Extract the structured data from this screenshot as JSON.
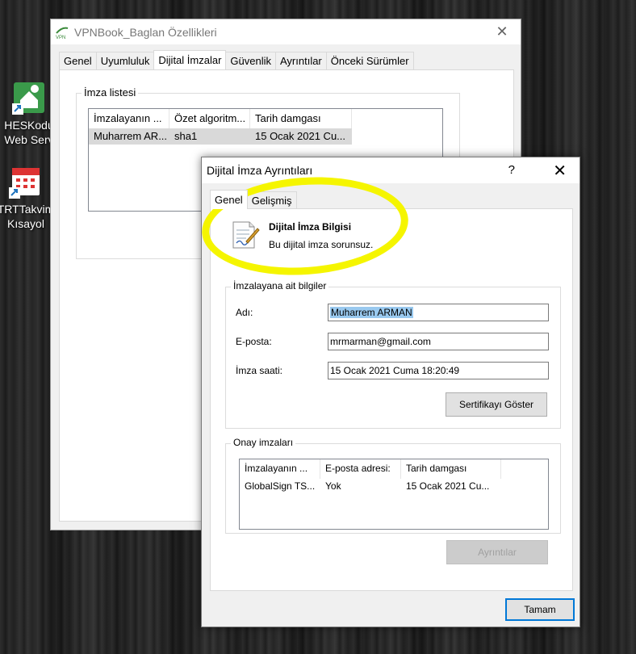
{
  "desktop": {
    "icons": [
      {
        "lines": [
          "HESKodu",
          "Web Serv"
        ]
      },
      {
        "lines": [
          "TRTTakvim",
          "Kısayol"
        ]
      }
    ]
  },
  "parent_window": {
    "title": "VPNBook_Baglan Özellikleri",
    "tabs": [
      "Genel",
      "Uyumluluk",
      "Dijital İmzalar",
      "Güvenlik",
      "Ayrıntılar",
      "Önceki Sürümler"
    ],
    "active_tab": "Dijital İmzalar",
    "signature_list": {
      "legend": "İmza listesi",
      "columns": [
        "İmzalayanın ...",
        "Özet algoritm...",
        "Tarih damgası"
      ],
      "rows": [
        [
          "Muharrem AR...",
          "sha1",
          "15 Ocak 2021 Cu..."
        ]
      ]
    }
  },
  "dialog": {
    "title": "Dijital İmza Ayrıntıları",
    "help": "?",
    "close": "✕",
    "tabs": [
      "Genel",
      "Gelişmiş"
    ],
    "active_tab": "Genel",
    "header": {
      "title": "Dijital İmza Bilgisi",
      "status": "Bu dijital imza sorunsuz."
    },
    "signer_info": {
      "legend": "İmzalayana ait bilgiler",
      "name_label": "Adı:",
      "name_value": "Muharrem ARMAN",
      "email_label": "E-posta:",
      "email_value": "mrmarman@gmail.com",
      "time_label": "İmza saati:",
      "time_value": "15 Ocak 2021 Cuma 18:20:49",
      "show_cert_button": "Sertifikayı Göster"
    },
    "countersignatures": {
      "legend": "Onay imzaları",
      "columns": [
        "İmzalayanın ...",
        "E-posta adresi:",
        "Tarih damgası"
      ],
      "rows": [
        [
          "GlobalSign TS...",
          "Yok",
          "15 Ocak 2021 Cu..."
        ]
      ],
      "details_button": "Ayrıntılar"
    },
    "ok_button": "Tamam"
  },
  "colors": {
    "highlight": "#f5f500",
    "selection": "#99c9ef",
    "focus_border": "#0078d7"
  }
}
